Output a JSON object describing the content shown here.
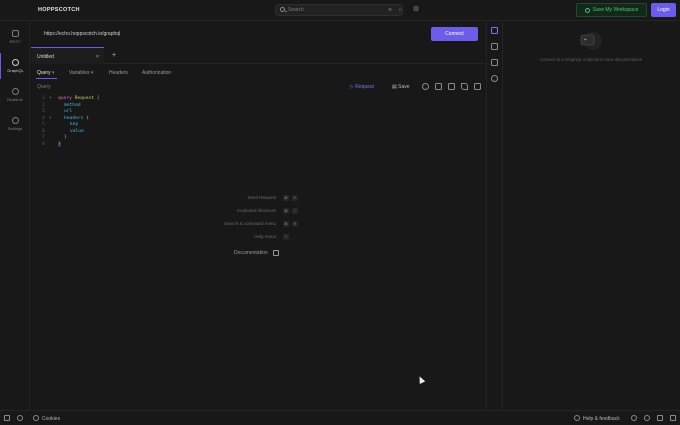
{
  "app": {
    "brand": "HOPPSCOTCH"
  },
  "header": {
    "search_label": "Search",
    "search_kbd": "⌘ K",
    "save_workspace": "Save My Workspace",
    "login": "Login"
  },
  "rail": {
    "items": [
      {
        "label": "REST",
        "icon": "rest-icon"
      },
      {
        "label": "GraphQL",
        "icon": "graphql-icon",
        "active": true
      },
      {
        "label": "Realtime",
        "icon": "realtime-icon"
      },
      {
        "label": "Settings",
        "icon": "settings-icon"
      }
    ]
  },
  "request": {
    "url": "https://echo.hoppscotch.io/graphql",
    "connect_label": "Connect",
    "tab_name": "Untitled",
    "tab_close": "×",
    "tab_add": "+",
    "subtabs": [
      "Query",
      "Variables",
      "Headers",
      "Authorization"
    ],
    "query_label": "Query",
    "request_label": "Request",
    "save_label": "Save"
  },
  "editor": {
    "line_numbers": [
      "1",
      "2",
      "3",
      "4",
      "5",
      "6",
      "7",
      "8"
    ]
  },
  "hints": {
    "items": [
      {
        "label": "Send Request",
        "keys": [
          "⌘",
          "↵"
        ]
      },
      {
        "label": "Keyboard shortcuts",
        "keys": [
          "⌘",
          "/"
        ]
      },
      {
        "label": "Search & command menu",
        "keys": [
          "⌘",
          "K"
        ]
      },
      {
        "label": "Help menu",
        "keys": [
          "?"
        ]
      }
    ],
    "documentation": "Documentation"
  },
  "docs_panel": {
    "message": "Connect to a GraphQL endpoint to view documentation"
  },
  "footer": {
    "cookies": "Cookies",
    "help": "Help & feedback"
  },
  "colors": {
    "accent": "#6c5ce7",
    "background": "#181818",
    "workspace_green": "#4cc37a"
  }
}
